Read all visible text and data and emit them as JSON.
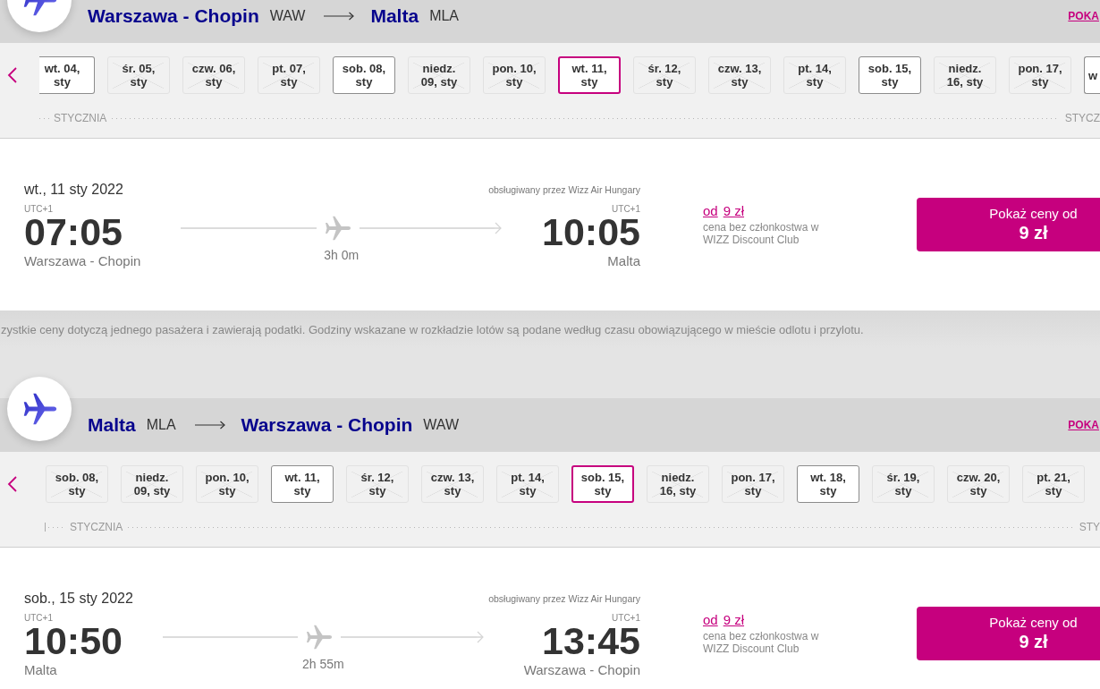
{
  "outbound": {
    "route": {
      "origin": {
        "name": "Warszawa - Chopin",
        "code": "WAW"
      },
      "destination": {
        "name": "Malta",
        "code": "MLA"
      },
      "link": "POKA"
    },
    "date_strip": {
      "start_cut": true,
      "days": [
        {
          "label": "wt. 04, sty",
          "selected": false,
          "disabled": false
        },
        {
          "label": "śr. 05, sty",
          "selected": false,
          "disabled": true
        },
        {
          "label": "czw. 06, sty",
          "selected": false,
          "disabled": true
        },
        {
          "label": "pt. 07, sty",
          "selected": false,
          "disabled": true
        },
        {
          "label": "sob. 08, sty",
          "selected": false,
          "disabled": false
        },
        {
          "label": "niedz. 09, sty",
          "selected": false,
          "disabled": true
        },
        {
          "label": "pon. 10, sty",
          "selected": false,
          "disabled": true
        },
        {
          "label": "wt. 11, sty",
          "selected": true,
          "disabled": false
        },
        {
          "label": "śr. 12, sty",
          "selected": false,
          "disabled": true
        },
        {
          "label": "czw. 13, sty",
          "selected": false,
          "disabled": true
        },
        {
          "label": "pt. 14, sty",
          "selected": false,
          "disabled": true
        },
        {
          "label": "sob. 15, sty",
          "selected": false,
          "disabled": false
        },
        {
          "label": "niedz. 16, sty",
          "selected": false,
          "disabled": true
        },
        {
          "label": "pon. 17, sty",
          "selected": false,
          "disabled": true
        }
      ],
      "trailing_day": "w",
      "months": [
        "STYCZNIA",
        "STYCZ"
      ]
    },
    "flight": {
      "date": "wt., 11 sty 2022",
      "operator": "obsługiwany przez Wizz Air Hungary",
      "departure": {
        "timezone": "UTC+1",
        "time": "07:05",
        "city": "Warszawa - Chopin"
      },
      "duration": "3h 0m",
      "arrival": {
        "timezone": "UTC+1",
        "time": "10:05",
        "city": "Malta"
      },
      "price": {
        "prefix": "od",
        "amount": "9 zł",
        "note": "cena bez członkostwa w WIZZ Discount Club"
      },
      "button": {
        "label": "Pokaż ceny od",
        "price": "9 zł"
      }
    }
  },
  "disclaimer": "zystkie ceny dotyczą jednego pasażera i zawierają podatki. Godziny wskazane w rozkładzie lotów są podane według czasu obowiązującego w mieście odlotu i przylotu.",
  "return": {
    "route": {
      "origin": {
        "name": "Malta",
        "code": "MLA"
      },
      "destination": {
        "name": "Warszawa - Chopin",
        "code": "WAW"
      },
      "link": "POKA"
    },
    "date_strip": {
      "start_cut": false,
      "days": [
        {
          "label": "sob. 08, sty",
          "selected": false,
          "disabled": true
        },
        {
          "label": "niedz. 09, sty",
          "selected": false,
          "disabled": true
        },
        {
          "label": "pon. 10, sty",
          "selected": false,
          "disabled": true
        },
        {
          "label": "wt. 11, sty",
          "selected": false,
          "disabled": false
        },
        {
          "label": "śr. 12, sty",
          "selected": false,
          "disabled": true
        },
        {
          "label": "czw. 13, sty",
          "selected": false,
          "disabled": true
        },
        {
          "label": "pt. 14, sty",
          "selected": false,
          "disabled": true
        },
        {
          "label": "sob. 15, sty",
          "selected": true,
          "disabled": false
        },
        {
          "label": "niedz. 16, sty",
          "selected": false,
          "disabled": true
        },
        {
          "label": "pon. 17, sty",
          "selected": false,
          "disabled": true
        },
        {
          "label": "wt. 18, sty",
          "selected": false,
          "disabled": false
        },
        {
          "label": "śr. 19, sty",
          "selected": false,
          "disabled": true
        },
        {
          "label": "czw. 20, sty",
          "selected": false,
          "disabled": true
        },
        {
          "label": "pt. 21, sty",
          "selected": false,
          "disabled": true
        }
      ],
      "months": [
        "STYCZNIA",
        "STY"
      ]
    },
    "flight": {
      "date": "sob., 15 sty 2022",
      "operator": "obsługiwany przez Wizz Air Hungary",
      "departure": {
        "timezone": "UTC+1",
        "time": "10:50",
        "city": "Malta"
      },
      "duration": "2h 55m",
      "arrival": {
        "timezone": "UTC+1",
        "time": "13:45",
        "city": "Warszawa - Chopin"
      },
      "price": {
        "prefix": "od",
        "amount": "9 zł",
        "note": "cena bez członkostwa w WIZZ Discount Club"
      },
      "button": {
        "label": "Pokaż ceny od",
        "price": "9 zł"
      }
    }
  }
}
